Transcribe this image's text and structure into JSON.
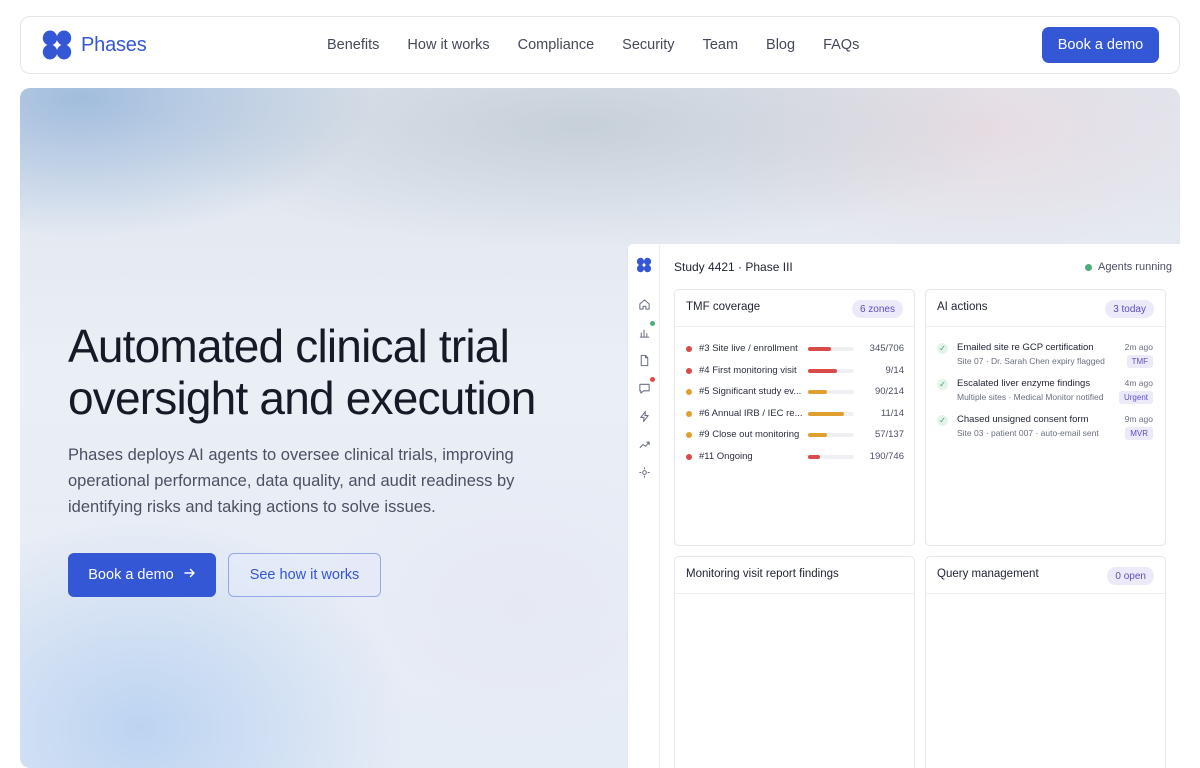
{
  "brand": {
    "name": "Phases",
    "accent": "#3457d5"
  },
  "nav": {
    "links": [
      "Benefits",
      "How it works",
      "Compliance",
      "Security",
      "Team",
      "Blog",
      "FAQs"
    ],
    "cta": "Book a demo"
  },
  "hero": {
    "title_line1": "Automated clinical trial",
    "title_line2": "oversight and execution",
    "subtitle": "Phases deploys AI agents to oversee clinical trials, improving operational performance, data quality, and audit readiness by identifying risks and taking actions to solve issues.",
    "primary_cta": "Book a demo",
    "primary_cta_icon": "arrow-right-icon",
    "secondary_cta": "See how it works"
  },
  "dashboard": {
    "study_title": "Study 4421 · Phase III",
    "status": "Agents running",
    "rail_icons": [
      "home-icon",
      "bar-chart-icon",
      "document-icon",
      "chat-icon",
      "bolt-icon",
      "trend-icon",
      "settings-icon"
    ],
    "tmf": {
      "title": "TMF coverage",
      "badge": "6 zones",
      "rows": [
        {
          "label": "#3 Site live / enrollment",
          "count": "345/706",
          "progress": 0.49,
          "color": "#d94a4a"
        },
        {
          "label": "#4 First monitoring visit",
          "count": "9/14",
          "progress": 0.64,
          "color": "#d94a4a"
        },
        {
          "label": "#5 Significant study ev...",
          "count": "90/214",
          "progress": 0.42,
          "color": "#e0a030"
        },
        {
          "label": "#6 Annual IRB / IEC re...",
          "count": "11/14",
          "progress": 0.79,
          "color": "#e0a030"
        },
        {
          "label": "#9 Close out monitoring",
          "count": "57/137",
          "progress": 0.42,
          "color": "#e0a030"
        },
        {
          "label": "#11 Ongoing",
          "count": "190/746",
          "progress": 0.25,
          "color": "#d94a4a"
        }
      ]
    },
    "ai_actions": {
      "title": "AI actions",
      "badge": "3 today",
      "items": [
        {
          "title": "Emailed site re GCP certification",
          "detail": "Site 07 · Dr. Sarah Chen expiry flagged",
          "time": "2m ago",
          "tag": "TMF"
        },
        {
          "title": "Escalated liver enzyme findings",
          "detail": "Multiple sites · Medical Monitor notified",
          "time": "4m ago",
          "tag": "Urgent"
        },
        {
          "title": "Chased unsigned consent form",
          "detail": "Site 03 · patient 007 · auto-email sent",
          "time": "9m ago",
          "tag": "MVR"
        }
      ]
    },
    "monitoring": {
      "title": "Monitoring visit report findings"
    },
    "queries": {
      "title": "Query management",
      "badge": "0 open"
    }
  }
}
